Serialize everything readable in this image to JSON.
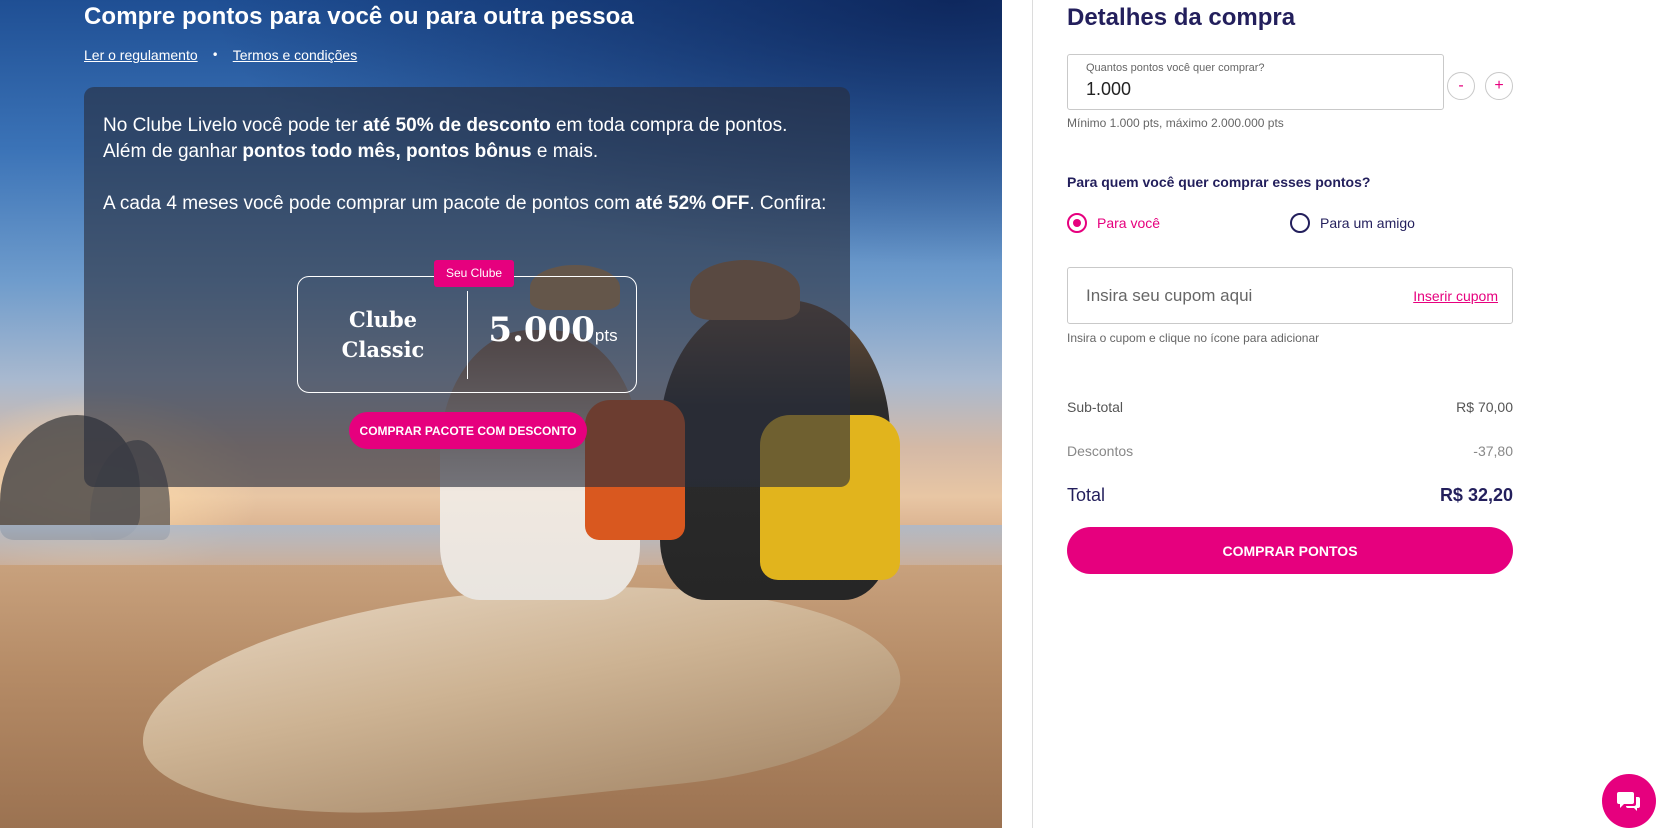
{
  "hero": {
    "title": "Compre pontos para você ou para outra pessoa",
    "links": {
      "rules": "Ler o regulamento",
      "separator": "•",
      "terms": "Termos e condições"
    },
    "promo": {
      "p1": {
        "a": "No Clube Livelo você pode ter ",
        "b": "até 50% de desconto",
        "c": " em toda compra de pontos. Além de ganhar ",
        "d": "pontos todo mês, pontos bônus",
        "e": " e mais."
      },
      "p2": {
        "a": "A cada 4 meses você pode comprar um pacote de pontos com ",
        "b": "até 52% OFF",
        "c": ". Confira:"
      },
      "club_badge": "Seu Clube",
      "club_name": "Clube Classic",
      "club_points": "5.000",
      "club_points_unit": "pts",
      "cta": "COMPRAR PACOTE COM DESCONTO"
    }
  },
  "panel": {
    "title": "Detalhes da compra",
    "quantity": {
      "label": "Quantos pontos você quer comprar?",
      "value": "1.000",
      "minus": "-",
      "plus": "+",
      "hint": "Mínimo 1.000 pts, máximo 2.000.000 pts"
    },
    "recipient": {
      "question": "Para quem você quer comprar esses pontos?",
      "option_self": "Para você",
      "option_friend": "Para um amigo",
      "selected": "self"
    },
    "coupon": {
      "placeholder": "Insira seu cupom aqui",
      "link": "Inserir cupom",
      "hint": "Insira o cupom e clique no ícone para adicionar"
    },
    "summary": {
      "subtotal_label": "Sub-total",
      "subtotal_value": "R$ 70,00",
      "discount_label": "Descontos",
      "discount_value": "-37,80",
      "total_label": "Total",
      "total_value": "R$ 32,20"
    },
    "buy_button": "COMPRAR PONTOS"
  },
  "chat": {
    "icon": "chat-bubbles-icon"
  },
  "colors": {
    "brand": "#e6007e",
    "navy": "#231f5c"
  }
}
